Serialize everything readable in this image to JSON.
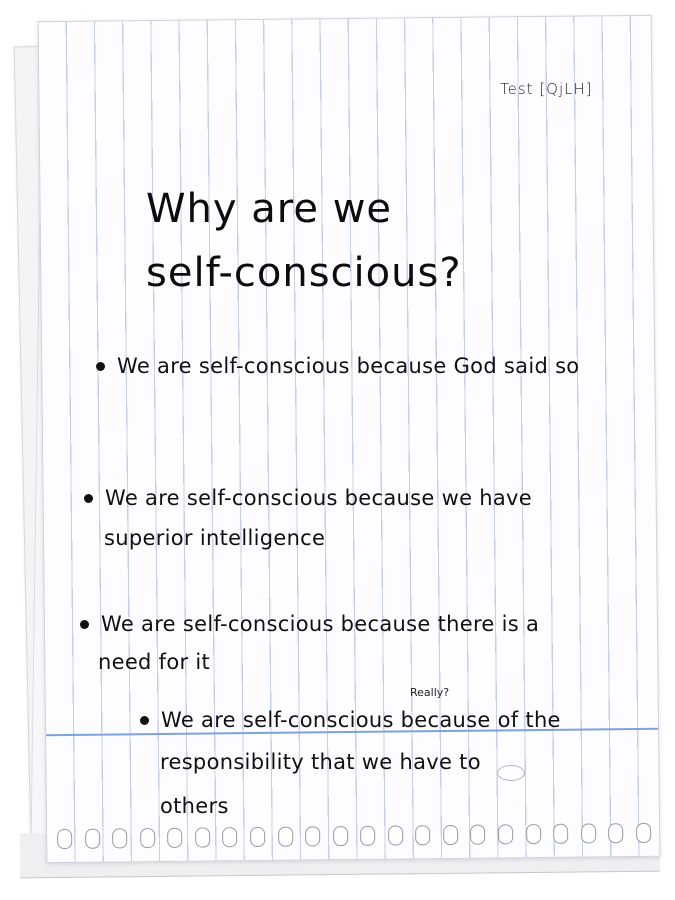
{
  "header": {
    "test_label": "Test [QjLH]"
  },
  "title": {
    "line1": "Why are we",
    "line2": "self-conscious?"
  },
  "bullets": [
    {
      "line1": "We are self-conscious because God said so"
    },
    {
      "line1": "We are self-conscious because we have",
      "line2": "superior intelligence"
    },
    {
      "line1": "We are self-conscious because there is a",
      "line2": "need for it"
    },
    {
      "line1": "We are self-conscious because of the",
      "line2": "responsibility that we have to",
      "line3": "others",
      "note": "Really?"
    }
  ]
}
